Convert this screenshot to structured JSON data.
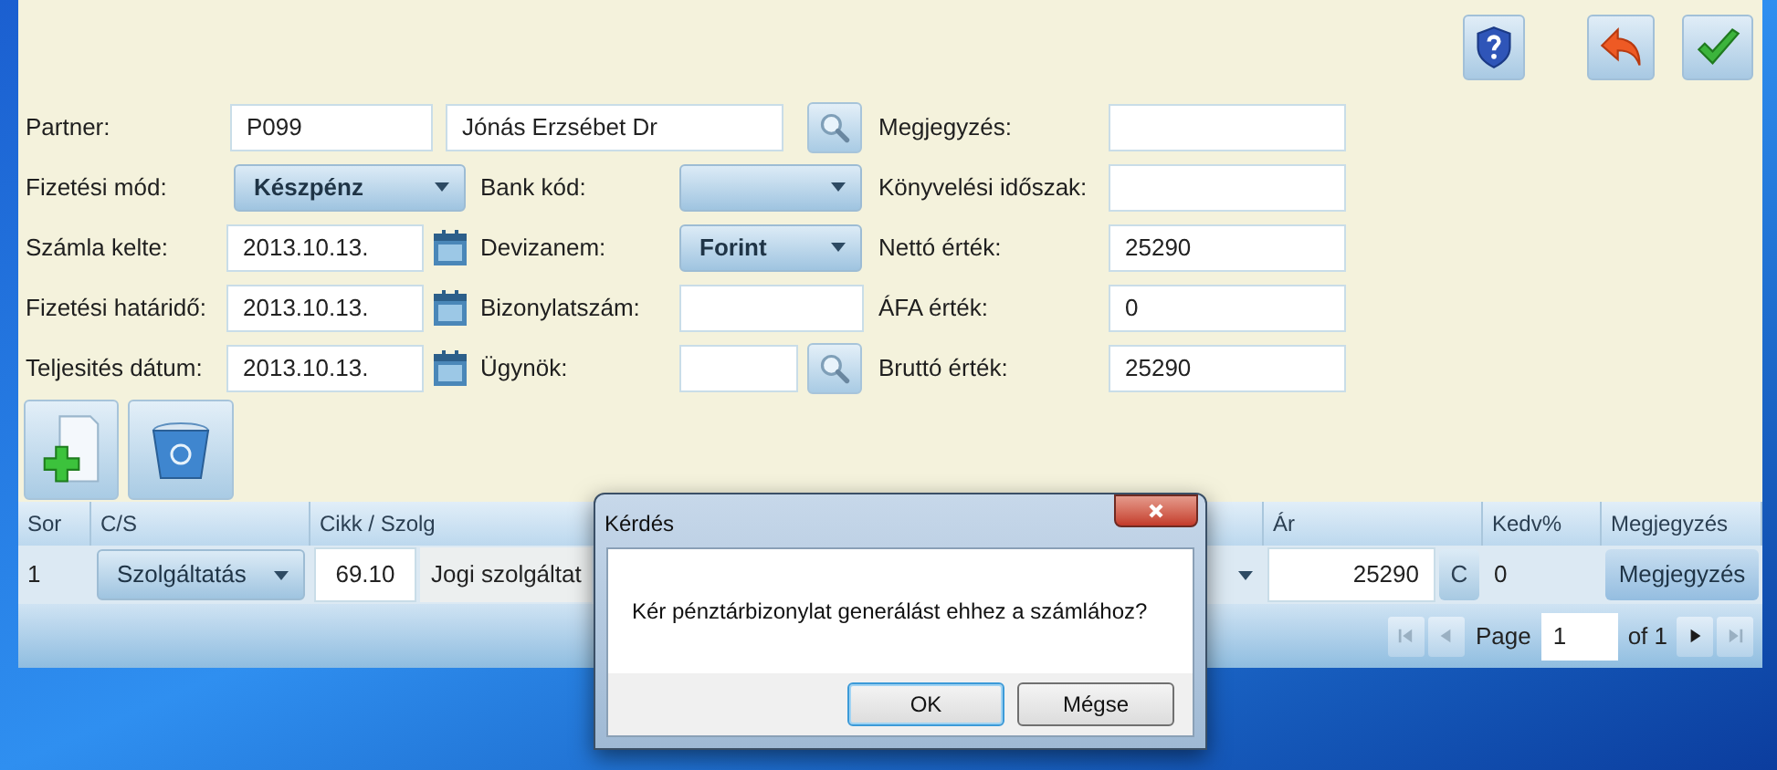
{
  "form": {
    "rows": [
      {
        "left": {
          "label": "Partner:",
          "kind": "code",
          "value": "P099"
        },
        "middle": {
          "kind": "name",
          "value": "Jónás Erzsébet Dr"
        },
        "right": {
          "label": "Megjegyzés:"
        }
      },
      {
        "left": {
          "label": "Fizetési mód:",
          "kind": "select",
          "value": "Készpénz"
        },
        "middle": {
          "label": "Bank kód:",
          "kind": "select"
        },
        "right": {
          "label": "Könyvelési időszak:"
        }
      },
      {
        "left": {
          "label": "Számla kelte:",
          "kind": "date",
          "value": "2013.10.13."
        },
        "middle": {
          "label": "Devizanem:",
          "kind": "select",
          "value": "Forint"
        },
        "right": {
          "label": "Nettó érték:",
          "value": "25290"
        }
      },
      {
        "left": {
          "label": "Fizetési határidő:",
          "kind": "date",
          "value": "2013.10.13."
        },
        "middle": {
          "label": "Bizonylatszám:",
          "kind": "input"
        },
        "right": {
          "label": "ÁFA érték:",
          "value": "0"
        }
      },
      {
        "left": {
          "label": "Teljesités dátum:",
          "kind": "date",
          "value": "2013.10.13."
        },
        "middle": {
          "label": "Ügynök:",
          "kind": "lookup"
        },
        "right": {
          "label": "Bruttó érték:",
          "value": "25290"
        }
      }
    ]
  },
  "grid": {
    "columns": [
      "Sor",
      "C/S",
      "Cikk / Szolg",
      "Ár",
      "Kedv%",
      "Megjegyzés"
    ],
    "rows": [
      {
        "sor": "1",
        "cs": "Szolgáltatás",
        "cikk_code": "69.10",
        "cikk_name": "Jogi szolgáltat",
        "ar": "25290",
        "ar_button": "C",
        "kedv": "0",
        "note_button": "Megjegyzés"
      }
    ],
    "pager": {
      "label": "Page",
      "value": "1",
      "of": "of 1"
    }
  },
  "dialog": {
    "title": "Kérdés",
    "message": "Kér pénztárbizonylat generálást ehhez a számlához?",
    "buttons": [
      {
        "label": "OK",
        "default": true
      },
      {
        "label": "Mégse",
        "default": false
      }
    ]
  }
}
